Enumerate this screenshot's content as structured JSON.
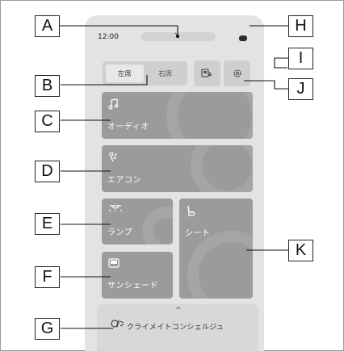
{
  "status": {
    "time": "12:00",
    "chevron": "⌄"
  },
  "seat_toggle": {
    "left": "左席",
    "right": "右席"
  },
  "tiles": {
    "audio": "オーディオ",
    "aircon": "エアコン",
    "lamp": "ランプ",
    "seat": "シート",
    "sunshade": "サンシェード"
  },
  "concierge": {
    "label": "クライメイトコンシェルジュ",
    "caret": "^"
  },
  "callouts": {
    "a": "A",
    "b": "B",
    "c": "C",
    "d": "D",
    "e": "E",
    "f": "F",
    "g": "G",
    "h": "H",
    "i": "I",
    "j": "J",
    "k": "K"
  },
  "icons": {
    "audio": "music-note-icon",
    "aircon": "climate-fan-icon",
    "lamp": "dome-lamp-icon",
    "seat": "seat-icon",
    "sunshade": "sunshade-icon",
    "concierge": "climate-concierge-icon",
    "rear": "rear-display-icon",
    "settings": "gear-icon"
  },
  "colors": {
    "tile": "#9b9b9b",
    "panel": "#e3e3e3"
  }
}
